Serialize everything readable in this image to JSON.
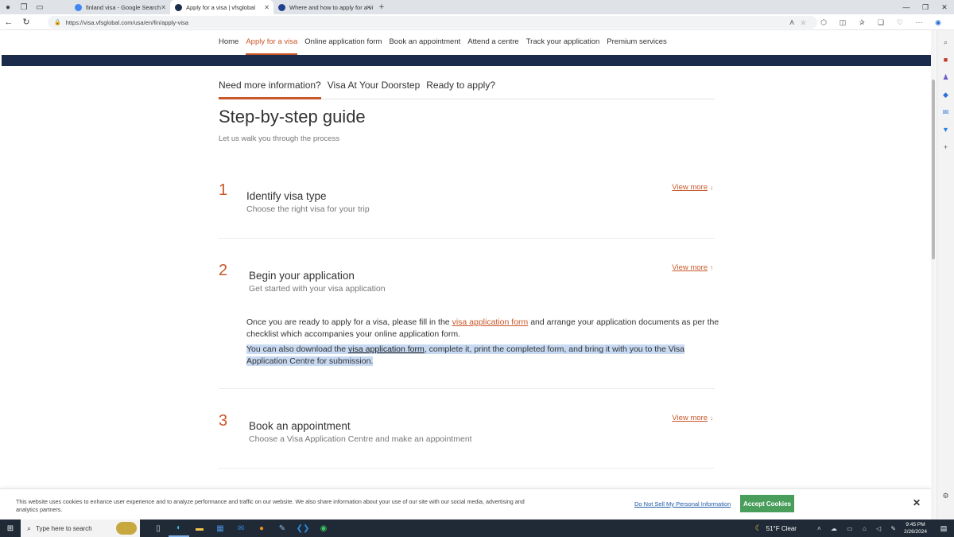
{
  "browser": {
    "tabs": [
      {
        "title": "finland visa - Google Search",
        "active": false,
        "favicon_color": "#4285f4"
      },
      {
        "title": "Apply for a visa | vfsglobal",
        "active": true,
        "favicon_color": "#1a2b4b"
      },
      {
        "title": "Where and how to apply for a vi",
        "active": false,
        "favicon_color": "#23408e"
      }
    ],
    "url": "https://visa.vfsglobal.com/usa/en/fin/apply-visa"
  },
  "site_nav": {
    "items": [
      "Home",
      "Apply for a visa",
      "Online application form",
      "Book an appointment",
      "Attend a centre",
      "Track your application",
      "Premium services"
    ],
    "active_index": 1
  },
  "subtabs": {
    "items": [
      "Need more information?",
      "Visa At Your Doorstep",
      "Ready to apply?"
    ],
    "active_index": 0
  },
  "guide": {
    "title": "Step-by-step guide",
    "subtitle": "Let us walk you through the process",
    "view_more": "View more",
    "steps": [
      {
        "num": "1",
        "title": "Identify visa type",
        "desc": "Choose the right visa for your trip",
        "arrow": "↓"
      },
      {
        "num": "2",
        "title": "Begin your application",
        "desc": "Get started with your visa application",
        "arrow": "↑",
        "para1_a": "Once you are ready to apply for a visa, please fill in the ",
        "para1_link": "visa application form",
        "para1_b": " and arrange your application documents as per the checklist which accompanies your online application form.",
        "para2_a": "You can also download the ",
        "para2_link": "visa application form",
        "para2_b": ", complete it, print the completed form, and bring it with you to the Visa Application Centre for submission."
      },
      {
        "num": "3",
        "title": "Book an appointment",
        "desc": "Choose a Visa Application Centre and make an appointment",
        "arrow": "↓"
      }
    ]
  },
  "cookie": {
    "text": "This website uses cookies to enhance user experience and to analyze performance and traffic on our website. We also share information about your use of our site with our social media, advertising and analytics partners.",
    "dns_label": "Do Not Sell My Personal Information",
    "accept_label": "Accept Cookies"
  },
  "taskbar": {
    "search_placeholder": "Type here to search",
    "weather": "51°F  Clear",
    "time": "9:45 PM",
    "date": "2/26/2024"
  },
  "colors": {
    "accent": "#c9572a",
    "navy": "#1a2b4b",
    "accept": "#4a9e5c",
    "highlight": "#c8d9f2"
  }
}
